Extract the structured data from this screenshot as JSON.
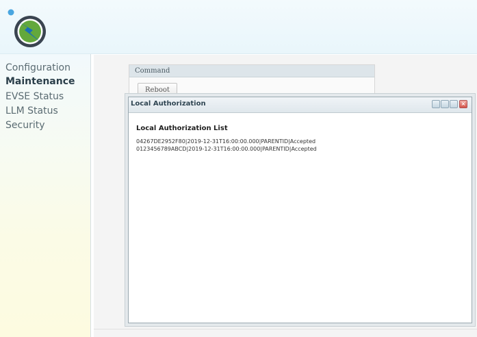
{
  "sidebar": {
    "items": [
      {
        "label": "Configuration",
        "active": false
      },
      {
        "label": "Maintenance",
        "active": true
      },
      {
        "label": "EVSE Status",
        "active": false
      },
      {
        "label": "LLM Status",
        "active": false
      },
      {
        "label": "Security",
        "active": false
      }
    ]
  },
  "command_panel": {
    "title": "Command",
    "reboot_label": "Reboot"
  },
  "dialog": {
    "title": "Local Authorization",
    "heading": "Local Authorization List",
    "rows": [
      "04267DE2952F80|2019-12-31T16:00:00.000|PARENTID|Accepted",
      "0123456789ABCD|2019-12-31T16:00:00.000|PARENTID|Accepted"
    ],
    "window_buttons": [
      {
        "icon": "minimize-icon"
      },
      {
        "icon": "maximize-icon"
      },
      {
        "icon": "restore-icon"
      },
      {
        "icon": "close-icon"
      }
    ]
  },
  "colors": {
    "logo_ring": "#3a4450",
    "logo_fill": "#63a83c",
    "logo_bolt": "#1a6fb5",
    "logo_accent": "#4aa6e0",
    "close_button": "#d2544a"
  }
}
